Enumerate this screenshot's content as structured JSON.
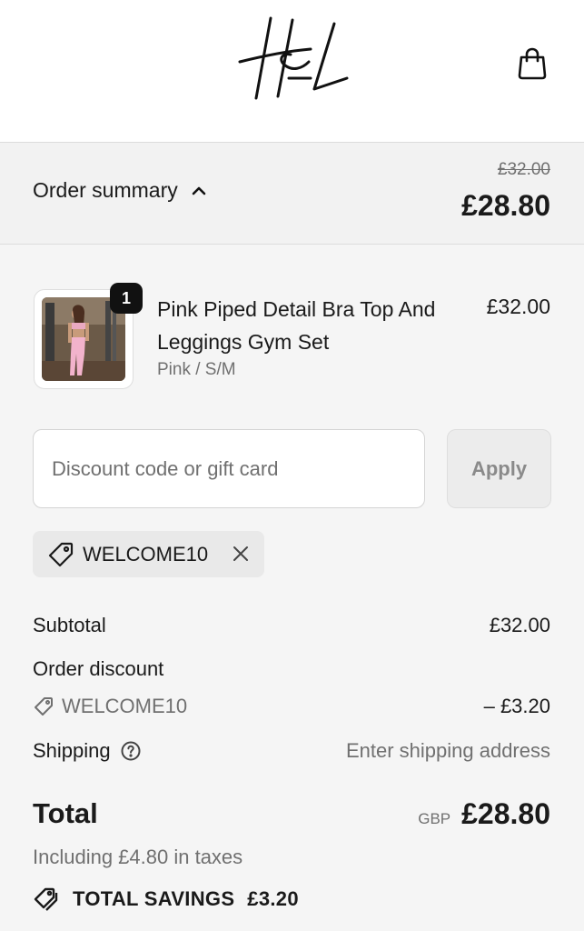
{
  "header": {
    "logo_text": "H&L",
    "bag_icon": "shopping-bag-icon"
  },
  "summary": {
    "toggle_label": "Order summary",
    "toggle_icon": "chevron-up-icon",
    "original_total": "£32.00",
    "total": "£28.80"
  },
  "cart": {
    "items": [
      {
        "name": "Pink Piped Detail Bra Top And Leggings Gym Set",
        "variant": "Pink / S/M",
        "price": "£32.00",
        "quantity": "1"
      }
    ]
  },
  "discount": {
    "placeholder": "Discount code or gift card",
    "value": "",
    "apply_label": "Apply",
    "applied_code": "WELCOME10"
  },
  "totals": {
    "subtotal_label": "Subtotal",
    "subtotal_value": "£32.00",
    "order_discount_label": "Order discount",
    "order_discount_code": "WELCOME10",
    "order_discount_value": "– £3.20",
    "shipping_label": "Shipping",
    "shipping_value": "Enter shipping address",
    "total_label": "Total",
    "currency": "GBP",
    "total_value": "£28.80",
    "taxes_note": "Including £4.80 in taxes",
    "savings_label": "TOTAL SAVINGS",
    "savings_value": "£3.20"
  },
  "colors": {
    "background": "#f5f5f5",
    "header_bg": "#ffffff",
    "text": "#1a1a1a",
    "muted": "#707070",
    "chip_bg": "#e9e9e9",
    "badge_bg": "#111111"
  }
}
